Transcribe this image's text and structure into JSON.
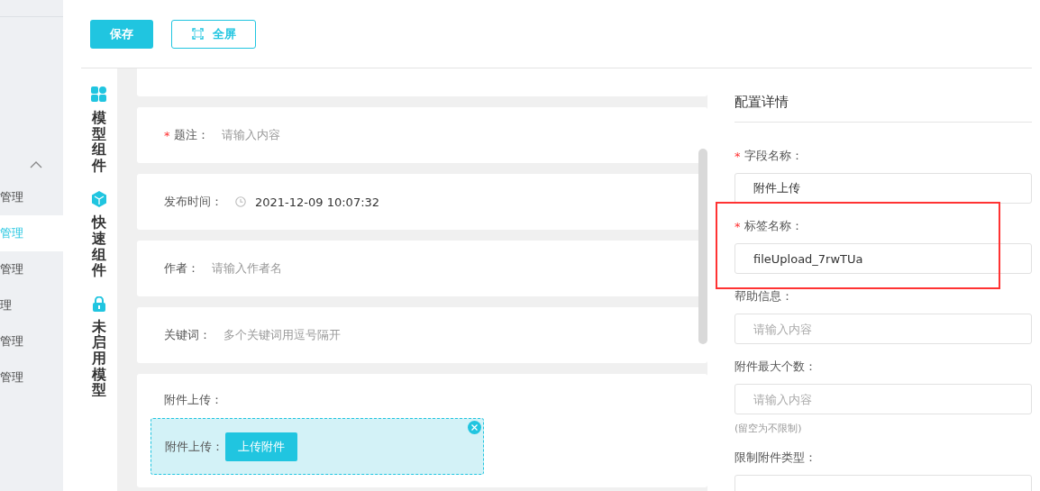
{
  "sidebar": {
    "items": [
      {
        "label": "管理",
        "selected": false
      },
      {
        "label": "管理",
        "selected": true
      },
      {
        "label": "管理",
        "selected": false
      },
      {
        "label": "理",
        "selected": false
      },
      {
        "label": "管理",
        "selected": false
      },
      {
        "label": "管理",
        "selected": false
      }
    ]
  },
  "toolbar": {
    "buttons": [
      {
        "kind": "primary",
        "label": "保存"
      },
      {
        "kind": "fullscreen",
        "label": "全屏"
      }
    ]
  },
  "component_nav": [
    {
      "kind": "grid",
      "label": "模型组件"
    },
    {
      "kind": "cube",
      "label": "快速组件"
    },
    {
      "kind": "lock",
      "label": "未启用模型"
    }
  ],
  "form_cards": [
    {
      "kind": "text",
      "required_mark": "*",
      "label": "题注：",
      "placeholder": "请输入内容"
    },
    {
      "kind": "datetime",
      "label": "发布时间：",
      "value": "2021-12-09 10:07:32"
    },
    {
      "kind": "text",
      "label": "作者：",
      "placeholder": "请输入作者名"
    },
    {
      "kind": "text",
      "label": "关键词：",
      "placeholder": "多个关键词用逗号隔开"
    },
    {
      "kind": "upload",
      "label": "附件上传：",
      "inner_label": "附件上传：",
      "button": "上传附件"
    }
  ],
  "config_panel": {
    "title": "配置详情",
    "fields": [
      {
        "required_mark": "*",
        "highlighted": false,
        "label": "字段名称：",
        "value": "附件上传"
      },
      {
        "required_mark": "*",
        "highlighted": true,
        "label": "标签名称：",
        "value": "fileUpload_7rwTUa"
      },
      {
        "highlighted": false,
        "label": "帮助信息：",
        "placeholder": "请输入内容"
      },
      {
        "highlighted": false,
        "label": "附件最大个数：",
        "placeholder": "请输入内容",
        "hint": "(留空为不限制)"
      },
      {
        "highlighted": false,
        "label": "限制附件类型："
      }
    ]
  }
}
